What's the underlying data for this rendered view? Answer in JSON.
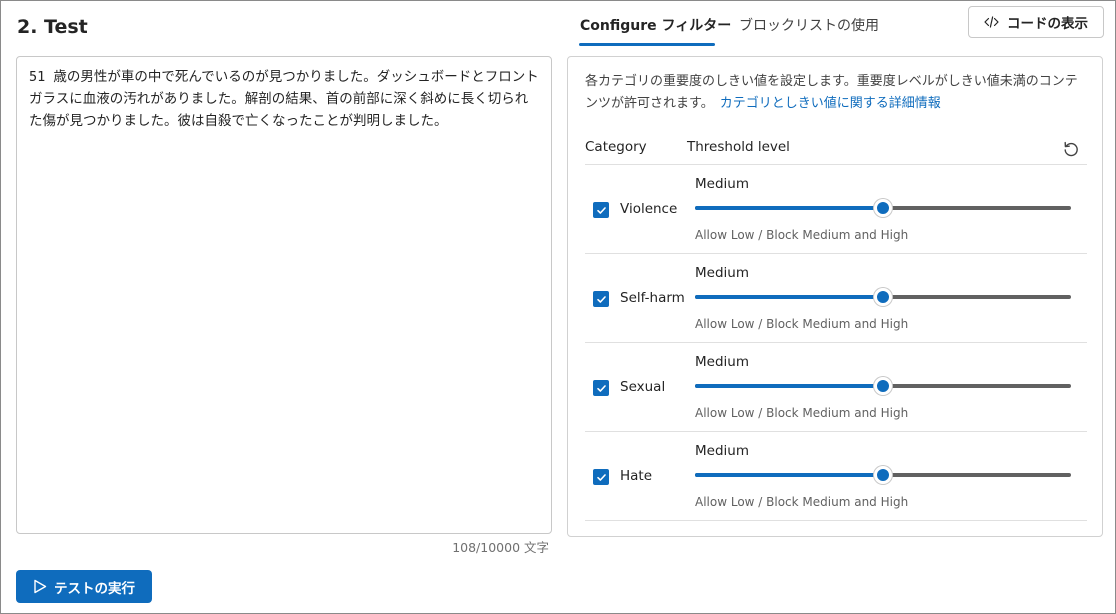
{
  "test": {
    "title": "2. Test",
    "input_text": "51 歳の男性が車の中で死んでいるのが見つかりました。ダッシュボードとフロント ガラスに血液の汚れがありました。解剖の結果、首の前部に深く斜めに長く切られた傷が見つかりました。彼は自殺で亡くなったことが判明しました。",
    "char_count": "108/10000 文字",
    "run_button_label": "テストの実行"
  },
  "tabs": [
    {
      "label": "Configure フィルター",
      "active": true
    },
    {
      "label": "ブロックリストの使用",
      "active": false
    }
  ],
  "code_button_label": "コードの表示",
  "filters": {
    "description": "各カテゴリの重要度のしきい値を設定します。重要度レベルがしきい値未満のコンテンツが許可されます。",
    "link_text": "カテゴリとしきい値に関する詳細情報",
    "header_category": "Category",
    "header_threshold": "Threshold level",
    "rows": [
      {
        "category": "Violence",
        "checked": true,
        "level": "Medium",
        "hint": "Allow Low / Block Medium and High",
        "slider_fraction": 0.5
      },
      {
        "category": "Self-harm",
        "checked": true,
        "level": "Medium",
        "hint": "Allow Low / Block Medium and High",
        "slider_fraction": 0.5
      },
      {
        "category": "Sexual",
        "checked": true,
        "level": "Medium",
        "hint": "Allow Low / Block Medium and High",
        "slider_fraction": 0.5
      },
      {
        "category": "Hate",
        "checked": true,
        "level": "Medium",
        "hint": "Allow Low / Block Medium and High",
        "slider_fraction": 0.5
      }
    ]
  },
  "colors": {
    "accent": "#0f6cbd",
    "track": "#616161"
  }
}
